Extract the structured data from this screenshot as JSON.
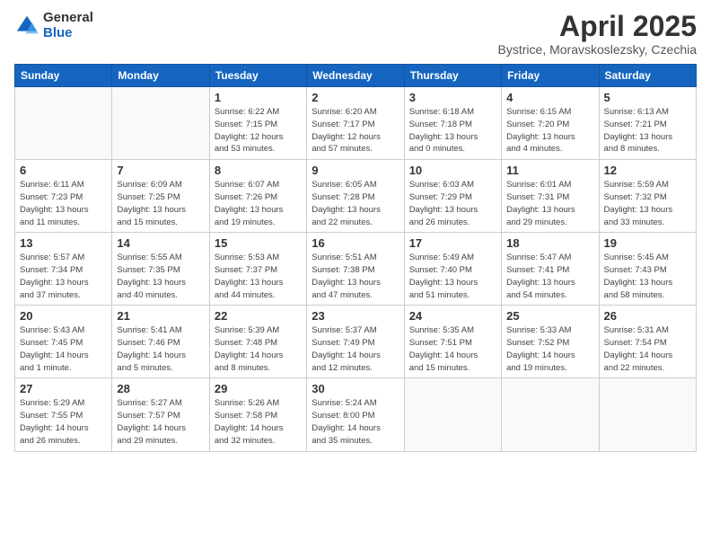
{
  "logo": {
    "general": "General",
    "blue": "Blue"
  },
  "title": "April 2025",
  "subtitle": "Bystrice, Moravskoslezsky, Czechia",
  "days_of_week": [
    "Sunday",
    "Monday",
    "Tuesday",
    "Wednesday",
    "Thursday",
    "Friday",
    "Saturday"
  ],
  "weeks": [
    [
      {
        "day": "",
        "info": ""
      },
      {
        "day": "",
        "info": ""
      },
      {
        "day": "1",
        "info": "Sunrise: 6:22 AM\nSunset: 7:15 PM\nDaylight: 12 hours\nand 53 minutes."
      },
      {
        "day": "2",
        "info": "Sunrise: 6:20 AM\nSunset: 7:17 PM\nDaylight: 12 hours\nand 57 minutes."
      },
      {
        "day": "3",
        "info": "Sunrise: 6:18 AM\nSunset: 7:18 PM\nDaylight: 13 hours\nand 0 minutes."
      },
      {
        "day": "4",
        "info": "Sunrise: 6:15 AM\nSunset: 7:20 PM\nDaylight: 13 hours\nand 4 minutes."
      },
      {
        "day": "5",
        "info": "Sunrise: 6:13 AM\nSunset: 7:21 PM\nDaylight: 13 hours\nand 8 minutes."
      }
    ],
    [
      {
        "day": "6",
        "info": "Sunrise: 6:11 AM\nSunset: 7:23 PM\nDaylight: 13 hours\nand 11 minutes."
      },
      {
        "day": "7",
        "info": "Sunrise: 6:09 AM\nSunset: 7:25 PM\nDaylight: 13 hours\nand 15 minutes."
      },
      {
        "day": "8",
        "info": "Sunrise: 6:07 AM\nSunset: 7:26 PM\nDaylight: 13 hours\nand 19 minutes."
      },
      {
        "day": "9",
        "info": "Sunrise: 6:05 AM\nSunset: 7:28 PM\nDaylight: 13 hours\nand 22 minutes."
      },
      {
        "day": "10",
        "info": "Sunrise: 6:03 AM\nSunset: 7:29 PM\nDaylight: 13 hours\nand 26 minutes."
      },
      {
        "day": "11",
        "info": "Sunrise: 6:01 AM\nSunset: 7:31 PM\nDaylight: 13 hours\nand 29 minutes."
      },
      {
        "day": "12",
        "info": "Sunrise: 5:59 AM\nSunset: 7:32 PM\nDaylight: 13 hours\nand 33 minutes."
      }
    ],
    [
      {
        "day": "13",
        "info": "Sunrise: 5:57 AM\nSunset: 7:34 PM\nDaylight: 13 hours\nand 37 minutes."
      },
      {
        "day": "14",
        "info": "Sunrise: 5:55 AM\nSunset: 7:35 PM\nDaylight: 13 hours\nand 40 minutes."
      },
      {
        "day": "15",
        "info": "Sunrise: 5:53 AM\nSunset: 7:37 PM\nDaylight: 13 hours\nand 44 minutes."
      },
      {
        "day": "16",
        "info": "Sunrise: 5:51 AM\nSunset: 7:38 PM\nDaylight: 13 hours\nand 47 minutes."
      },
      {
        "day": "17",
        "info": "Sunrise: 5:49 AM\nSunset: 7:40 PM\nDaylight: 13 hours\nand 51 minutes."
      },
      {
        "day": "18",
        "info": "Sunrise: 5:47 AM\nSunset: 7:41 PM\nDaylight: 13 hours\nand 54 minutes."
      },
      {
        "day": "19",
        "info": "Sunrise: 5:45 AM\nSunset: 7:43 PM\nDaylight: 13 hours\nand 58 minutes."
      }
    ],
    [
      {
        "day": "20",
        "info": "Sunrise: 5:43 AM\nSunset: 7:45 PM\nDaylight: 14 hours\nand 1 minute."
      },
      {
        "day": "21",
        "info": "Sunrise: 5:41 AM\nSunset: 7:46 PM\nDaylight: 14 hours\nand 5 minutes."
      },
      {
        "day": "22",
        "info": "Sunrise: 5:39 AM\nSunset: 7:48 PM\nDaylight: 14 hours\nand 8 minutes."
      },
      {
        "day": "23",
        "info": "Sunrise: 5:37 AM\nSunset: 7:49 PM\nDaylight: 14 hours\nand 12 minutes."
      },
      {
        "day": "24",
        "info": "Sunrise: 5:35 AM\nSunset: 7:51 PM\nDaylight: 14 hours\nand 15 minutes."
      },
      {
        "day": "25",
        "info": "Sunrise: 5:33 AM\nSunset: 7:52 PM\nDaylight: 14 hours\nand 19 minutes."
      },
      {
        "day": "26",
        "info": "Sunrise: 5:31 AM\nSunset: 7:54 PM\nDaylight: 14 hours\nand 22 minutes."
      }
    ],
    [
      {
        "day": "27",
        "info": "Sunrise: 5:29 AM\nSunset: 7:55 PM\nDaylight: 14 hours\nand 26 minutes."
      },
      {
        "day": "28",
        "info": "Sunrise: 5:27 AM\nSunset: 7:57 PM\nDaylight: 14 hours\nand 29 minutes."
      },
      {
        "day": "29",
        "info": "Sunrise: 5:26 AM\nSunset: 7:58 PM\nDaylight: 14 hours\nand 32 minutes."
      },
      {
        "day": "30",
        "info": "Sunrise: 5:24 AM\nSunset: 8:00 PM\nDaylight: 14 hours\nand 35 minutes."
      },
      {
        "day": "",
        "info": ""
      },
      {
        "day": "",
        "info": ""
      },
      {
        "day": "",
        "info": ""
      }
    ]
  ]
}
